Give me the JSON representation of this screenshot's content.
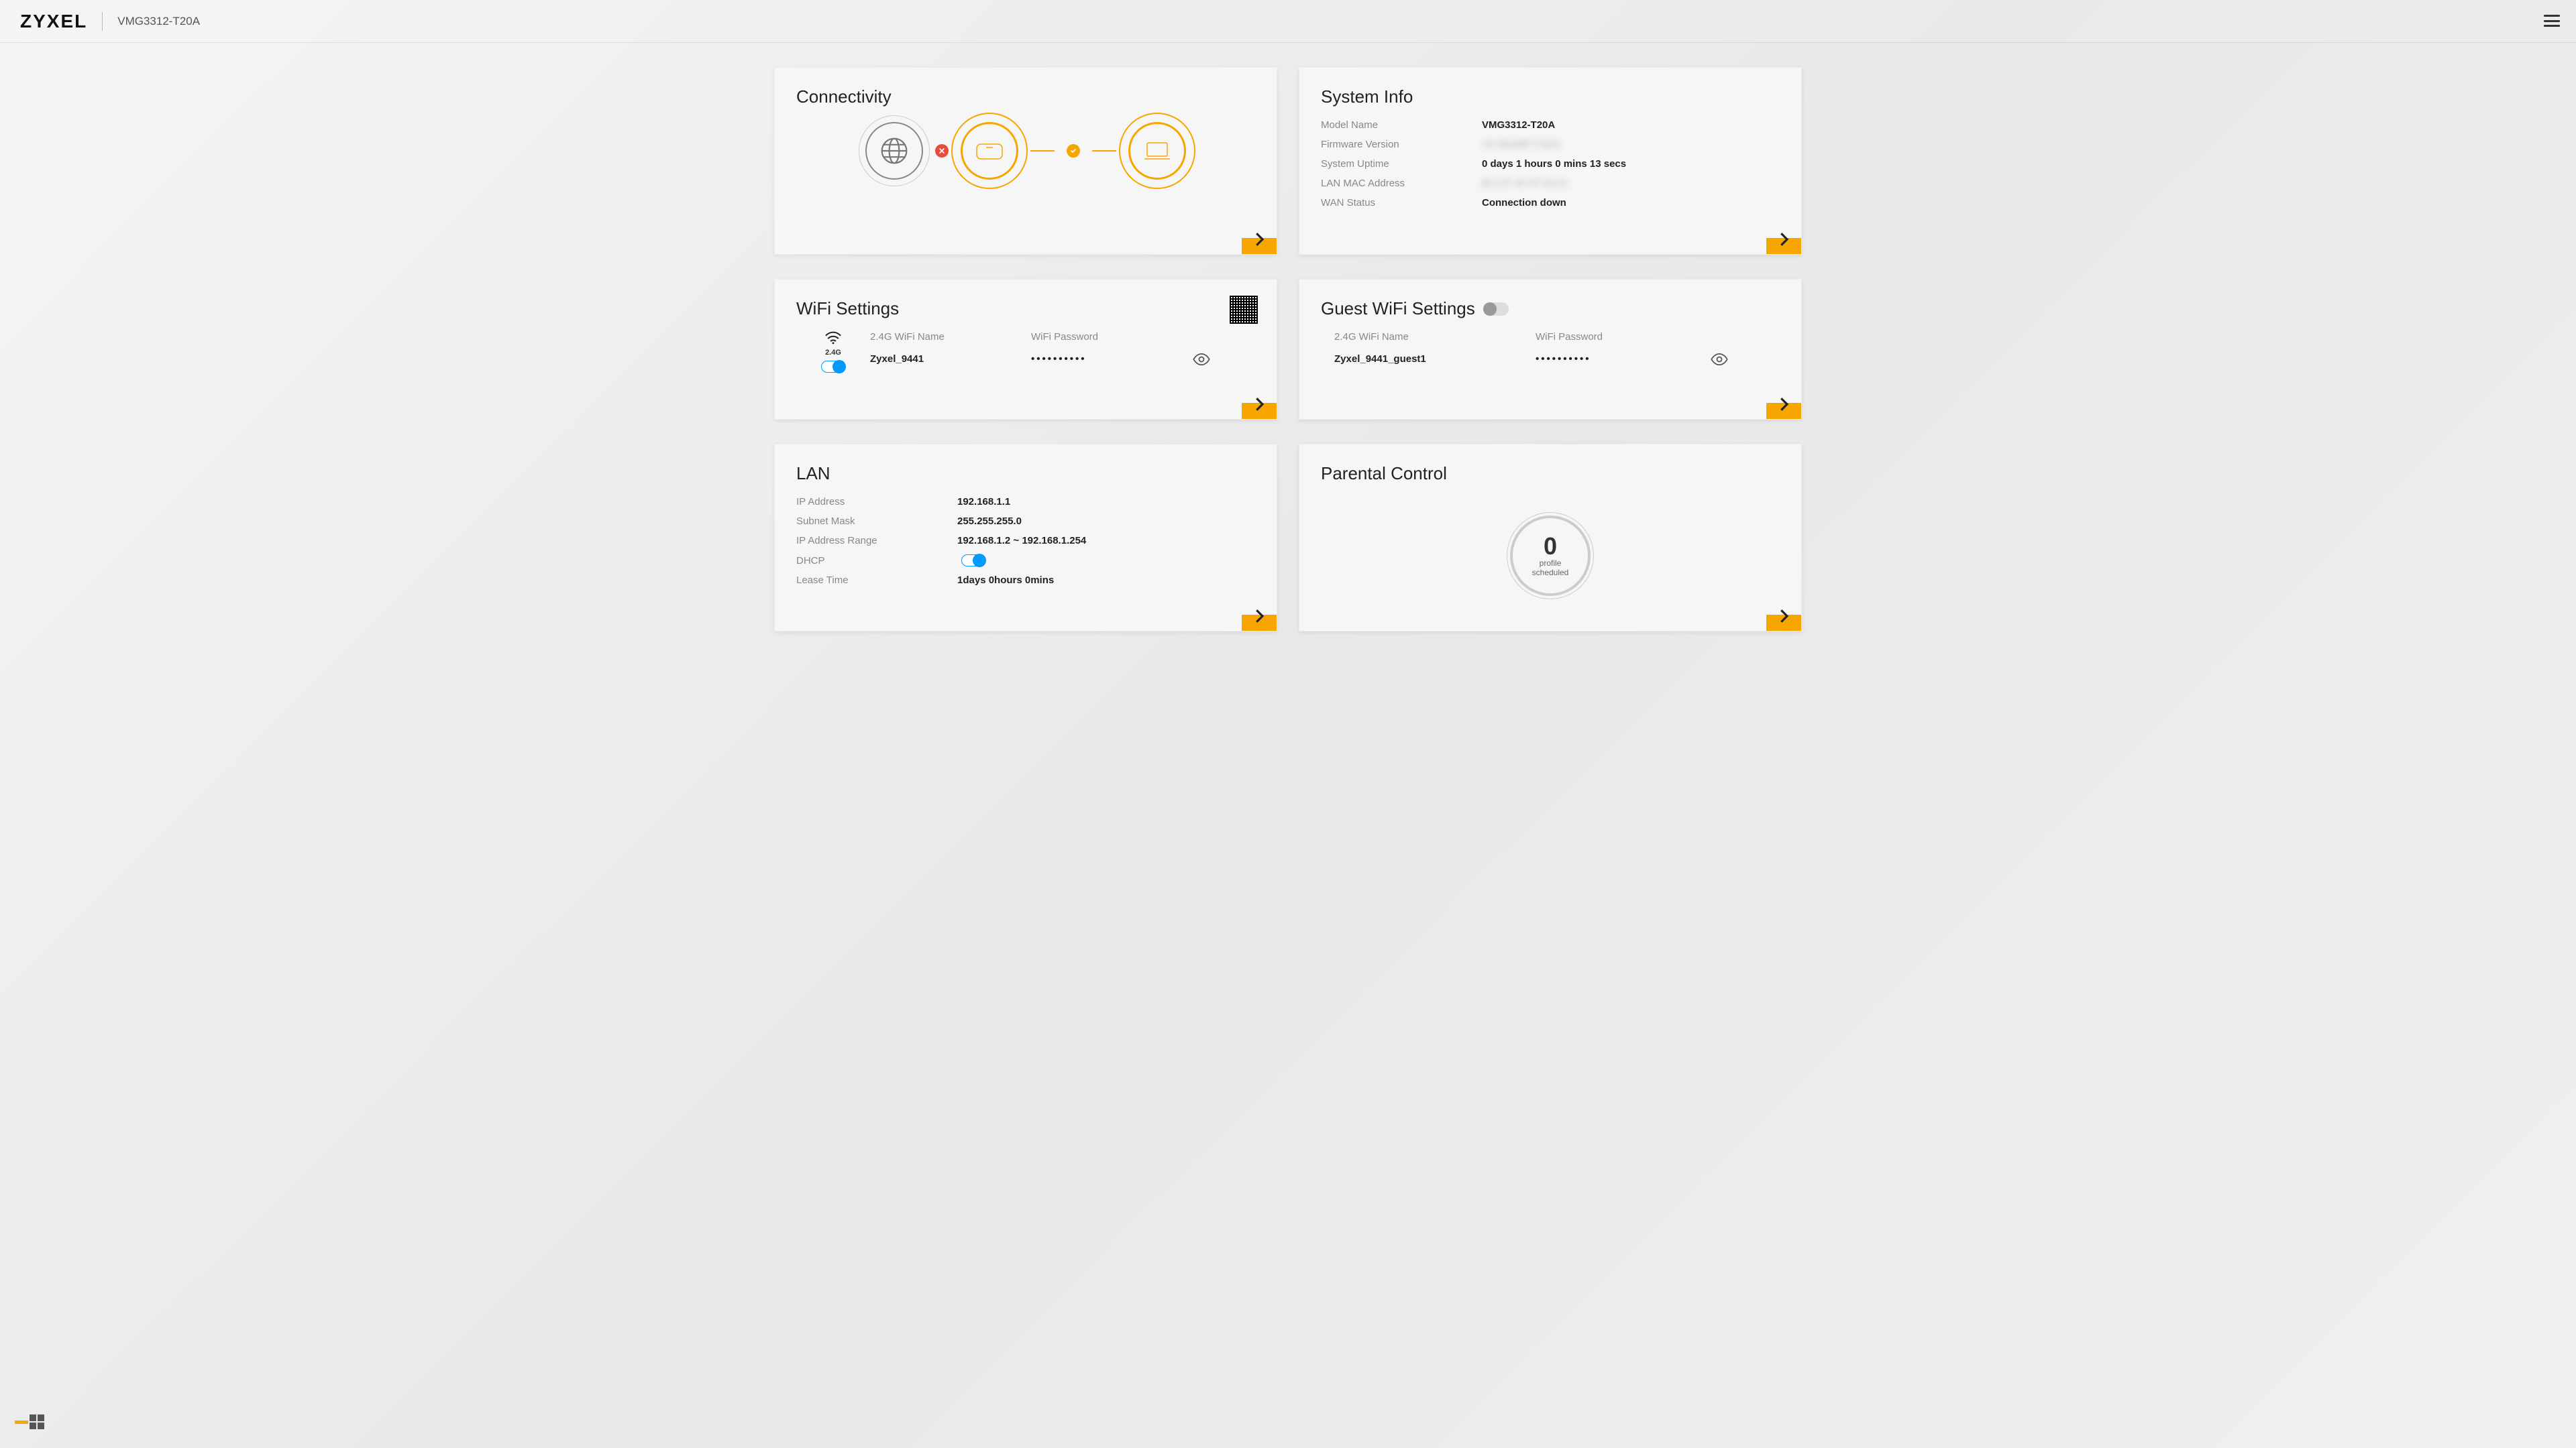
{
  "header": {
    "brand": "ZYXEL",
    "model": "VMG3312-T20A"
  },
  "cards": {
    "connectivity": {
      "title": "Connectivity"
    },
    "sysinfo": {
      "title": "System Info",
      "rows": {
        "model_label": "Model Name",
        "model_value": "VMG3312-T20A",
        "fw_label": "Firmware Version",
        "fw_value": "V5.30(ABFT.5)C0",
        "uptime_label": "System Uptime",
        "uptime_value": "0 days 1 hours 0 mins 13 secs",
        "mac_label": "LAN MAC Address",
        "mac_value": "BC:CF:4F:97:94:41",
        "wan_label": "WAN Status",
        "wan_value": "Connection down"
      }
    },
    "wifi": {
      "title": "WiFi Settings",
      "band_label": "2.4G",
      "name_label": "2.4G WiFi Name",
      "name_value": "Zyxel_9441",
      "pass_label": "WiFi Password",
      "pass_value": "••••••••••"
    },
    "guest": {
      "title": "Guest WiFi Settings",
      "name_label": "2.4G WiFi Name",
      "name_value": "Zyxel_9441_guest1",
      "pass_label": "WiFi Password",
      "pass_value": "••••••••••"
    },
    "lan": {
      "title": "LAN",
      "ip_label": "IP Address",
      "ip_value": "192.168.1.1",
      "mask_label": "Subnet Mask",
      "mask_value": "255.255.255.0",
      "range_label": "IP Address Range",
      "range_value": "192.168.1.2 ~ 192.168.1.254",
      "dhcp_label": "DHCP",
      "lease_label": "Lease Time",
      "lease_value": "1days 0hours 0mins"
    },
    "parental": {
      "title": "Parental Control",
      "count": "0",
      "line1": "profile",
      "line2": "scheduled"
    }
  }
}
